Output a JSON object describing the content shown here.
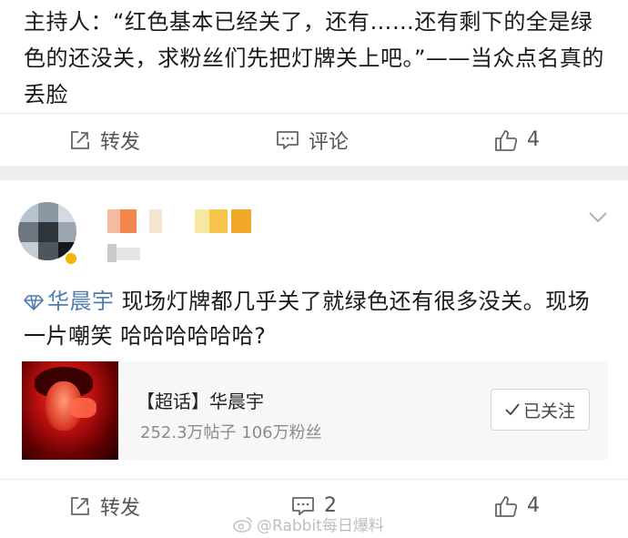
{
  "post1": {
    "text": "主持人：“红色基本已经关了，还有……还有剩下的全是绿色的还没关，求粉丝们先把灯牌关上吧。”——当众点名真的丢脸",
    "actions": {
      "repost_label": "转发",
      "comment_label": "评论",
      "like_count": "4"
    }
  },
  "post2": {
    "topic_name": "华晨宇",
    "text": " 现场灯牌都几乎关了就绿色还有很多没关。现场一片嘲笑 哈哈哈哈哈哈?",
    "card": {
      "title": "【超话】华晨宇",
      "stats": "252.3万帖子 106万粉丝",
      "follow_label": "已关注"
    },
    "actions": {
      "repost_label": "转发",
      "comment_count": "2",
      "like_count": "4"
    }
  },
  "watermark": {
    "text": "@Rabbit每日爆料"
  },
  "colors": {
    "topic_link": "#507daf",
    "accent_orange": "#eb7350",
    "separator": "#eeeeee"
  }
}
